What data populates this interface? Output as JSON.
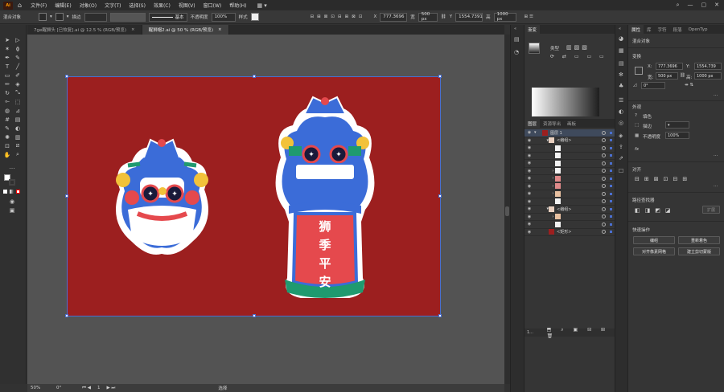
{
  "menubar": {
    "logo": "Ai",
    "menus": [
      "文件(F)",
      "编辑(E)",
      "对象(O)",
      "文字(T)",
      "选择(S)",
      "效果(C)",
      "视图(V)",
      "窗口(W)",
      "帮助(H)"
    ]
  },
  "controlbar": {
    "object_label": "混合对象",
    "stroke_label": "描边",
    "stroke_style": "基本",
    "opacity_label": "不透明度",
    "opacity_value": "100%",
    "style_label": "样式",
    "x_label": "X",
    "x_value": "777.3696",
    "w_label": "宽",
    "w_value": "500 px",
    "y_label": "Y",
    "y_value": "1554.7391",
    "h_label": "高",
    "h_value": "1000 px"
  },
  "doc_tabs": [
    {
      "label": "7ge醒狮头 [已恢复].ai @ 12.5 % (RGB/预览)",
      "close": "×"
    },
    {
      "label": "醒狮帽2.ai @ 50 % (RGB/预览)",
      "close": "×"
    }
  ],
  "statusbar": {
    "zoom": "50%",
    "rotation": "0°",
    "artboard": "1",
    "tool": "选择"
  },
  "artwork": {
    "slogan": [
      "狮",
      "季",
      "平",
      "安"
    ],
    "colors": {
      "bg": "#9c1f1f",
      "blue": "#3b6cd8",
      "red": "#e5494d",
      "green": "#1f9a6f",
      "yellow": "#f2c23a",
      "white": "#ffffff"
    }
  },
  "gradient_panel": {
    "tab": "渐变",
    "type_label": "类型"
  },
  "layers_panel": {
    "tabs": [
      "图层",
      "资源导出",
      "画板"
    ],
    "rows": [
      {
        "name": "图层 1",
        "indent": 0
      },
      {
        "name": "<编组>",
        "indent": 1
      },
      {
        "name": "",
        "indent": 2
      },
      {
        "name": "",
        "indent": 2
      },
      {
        "name": "",
        "indent": 2
      },
      {
        "name": "",
        "indent": 2
      },
      {
        "name": "",
        "indent": 2
      },
      {
        "name": "",
        "indent": 2
      },
      {
        "name": "",
        "indent": 2
      },
      {
        "name": "",
        "indent": 2
      },
      {
        "name": "<编组>",
        "indent": 1
      },
      {
        "name": "",
        "indent": 2
      },
      {
        "name": "",
        "indent": 2
      },
      {
        "name": "<矩形>",
        "indent": 1
      }
    ],
    "footer_count": "1..."
  },
  "properties": {
    "tabs": [
      "属性",
      "库",
      "字符",
      "段落",
      "OpenTyp"
    ],
    "object_type": "混合对象",
    "transform_label": "变换",
    "x_label": "X:",
    "x_value": "777.3696",
    "y_label": "Y:",
    "y_value": "1554.739",
    "w_label": "宽:",
    "w_value": "500 px",
    "h_label": "高:",
    "h_value": "1000 px",
    "angle_value": "0°",
    "appearance_label": "外观",
    "fill_label": "填色",
    "stroke_label": "描边",
    "opacity_label": "不透明度",
    "opacity_value": "100%",
    "fx_label": "fx",
    "align_label": "对齐",
    "pathfinder_label": "路径查找器",
    "expand_label": "扩展",
    "quick_actions_label": "快速操作",
    "btn_edit": "编组",
    "btn_recolor": "重新着色",
    "btn_align_pixel": "对齐像素网格",
    "btn_clip": "建立剪切蒙版"
  }
}
